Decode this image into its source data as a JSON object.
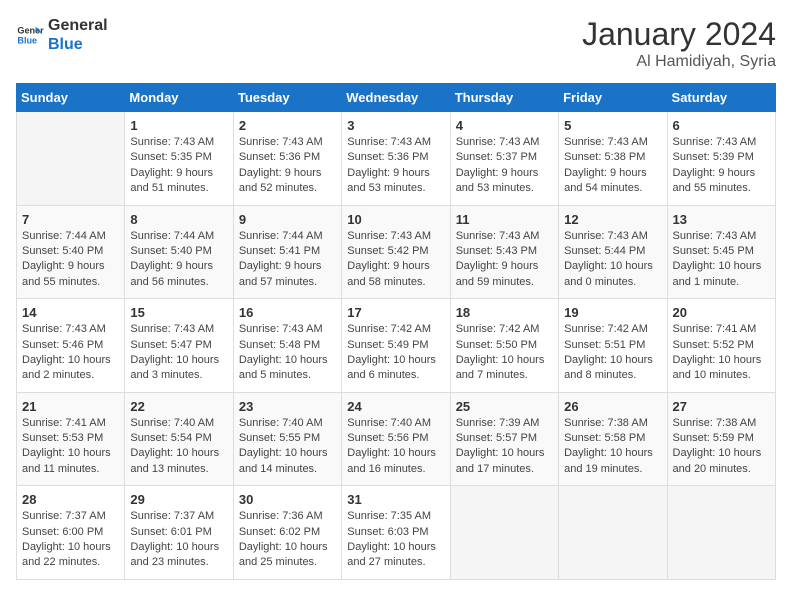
{
  "logo": {
    "line1": "General",
    "line2": "Blue"
  },
  "title": "January 2024",
  "location": "Al Hamidiyah, Syria",
  "weekdays": [
    "Sunday",
    "Monday",
    "Tuesday",
    "Wednesday",
    "Thursday",
    "Friday",
    "Saturday"
  ],
  "weeks": [
    [
      {
        "day": "",
        "info": ""
      },
      {
        "day": "1",
        "info": "Sunrise: 7:43 AM\nSunset: 5:35 PM\nDaylight: 9 hours\nand 51 minutes."
      },
      {
        "day": "2",
        "info": "Sunrise: 7:43 AM\nSunset: 5:36 PM\nDaylight: 9 hours\nand 52 minutes."
      },
      {
        "day": "3",
        "info": "Sunrise: 7:43 AM\nSunset: 5:36 PM\nDaylight: 9 hours\nand 53 minutes."
      },
      {
        "day": "4",
        "info": "Sunrise: 7:43 AM\nSunset: 5:37 PM\nDaylight: 9 hours\nand 53 minutes."
      },
      {
        "day": "5",
        "info": "Sunrise: 7:43 AM\nSunset: 5:38 PM\nDaylight: 9 hours\nand 54 minutes."
      },
      {
        "day": "6",
        "info": "Sunrise: 7:43 AM\nSunset: 5:39 PM\nDaylight: 9 hours\nand 55 minutes."
      }
    ],
    [
      {
        "day": "7",
        "info": "Sunrise: 7:44 AM\nSunset: 5:40 PM\nDaylight: 9 hours\nand 55 minutes."
      },
      {
        "day": "8",
        "info": "Sunrise: 7:44 AM\nSunset: 5:40 PM\nDaylight: 9 hours\nand 56 minutes."
      },
      {
        "day": "9",
        "info": "Sunrise: 7:44 AM\nSunset: 5:41 PM\nDaylight: 9 hours\nand 57 minutes."
      },
      {
        "day": "10",
        "info": "Sunrise: 7:43 AM\nSunset: 5:42 PM\nDaylight: 9 hours\nand 58 minutes."
      },
      {
        "day": "11",
        "info": "Sunrise: 7:43 AM\nSunset: 5:43 PM\nDaylight: 9 hours\nand 59 minutes."
      },
      {
        "day": "12",
        "info": "Sunrise: 7:43 AM\nSunset: 5:44 PM\nDaylight: 10 hours\nand 0 minutes."
      },
      {
        "day": "13",
        "info": "Sunrise: 7:43 AM\nSunset: 5:45 PM\nDaylight: 10 hours\nand 1 minute."
      }
    ],
    [
      {
        "day": "14",
        "info": "Sunrise: 7:43 AM\nSunset: 5:46 PM\nDaylight: 10 hours\nand 2 minutes."
      },
      {
        "day": "15",
        "info": "Sunrise: 7:43 AM\nSunset: 5:47 PM\nDaylight: 10 hours\nand 3 minutes."
      },
      {
        "day": "16",
        "info": "Sunrise: 7:43 AM\nSunset: 5:48 PM\nDaylight: 10 hours\nand 5 minutes."
      },
      {
        "day": "17",
        "info": "Sunrise: 7:42 AM\nSunset: 5:49 PM\nDaylight: 10 hours\nand 6 minutes."
      },
      {
        "day": "18",
        "info": "Sunrise: 7:42 AM\nSunset: 5:50 PM\nDaylight: 10 hours\nand 7 minutes."
      },
      {
        "day": "19",
        "info": "Sunrise: 7:42 AM\nSunset: 5:51 PM\nDaylight: 10 hours\nand 8 minutes."
      },
      {
        "day": "20",
        "info": "Sunrise: 7:41 AM\nSunset: 5:52 PM\nDaylight: 10 hours\nand 10 minutes."
      }
    ],
    [
      {
        "day": "21",
        "info": "Sunrise: 7:41 AM\nSunset: 5:53 PM\nDaylight: 10 hours\nand 11 minutes."
      },
      {
        "day": "22",
        "info": "Sunrise: 7:40 AM\nSunset: 5:54 PM\nDaylight: 10 hours\nand 13 minutes."
      },
      {
        "day": "23",
        "info": "Sunrise: 7:40 AM\nSunset: 5:55 PM\nDaylight: 10 hours\nand 14 minutes."
      },
      {
        "day": "24",
        "info": "Sunrise: 7:40 AM\nSunset: 5:56 PM\nDaylight: 10 hours\nand 16 minutes."
      },
      {
        "day": "25",
        "info": "Sunrise: 7:39 AM\nSunset: 5:57 PM\nDaylight: 10 hours\nand 17 minutes."
      },
      {
        "day": "26",
        "info": "Sunrise: 7:38 AM\nSunset: 5:58 PM\nDaylight: 10 hours\nand 19 minutes."
      },
      {
        "day": "27",
        "info": "Sunrise: 7:38 AM\nSunset: 5:59 PM\nDaylight: 10 hours\nand 20 minutes."
      }
    ],
    [
      {
        "day": "28",
        "info": "Sunrise: 7:37 AM\nSunset: 6:00 PM\nDaylight: 10 hours\nand 22 minutes."
      },
      {
        "day": "29",
        "info": "Sunrise: 7:37 AM\nSunset: 6:01 PM\nDaylight: 10 hours\nand 23 minutes."
      },
      {
        "day": "30",
        "info": "Sunrise: 7:36 AM\nSunset: 6:02 PM\nDaylight: 10 hours\nand 25 minutes."
      },
      {
        "day": "31",
        "info": "Sunrise: 7:35 AM\nSunset: 6:03 PM\nDaylight: 10 hours\nand 27 minutes."
      },
      {
        "day": "",
        "info": ""
      },
      {
        "day": "",
        "info": ""
      },
      {
        "day": "",
        "info": ""
      }
    ]
  ]
}
